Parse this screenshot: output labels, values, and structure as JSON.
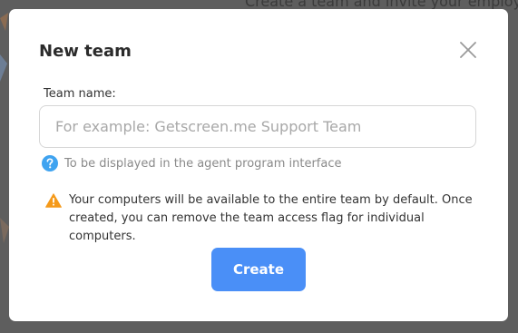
{
  "background": {
    "partial_text": "Create a team and invite your employee"
  },
  "modal": {
    "title": "New team",
    "close_icon": "close-icon",
    "team_name": {
      "label": "Team name:",
      "value": "",
      "placeholder": "For example: Getscreen.me Support Team"
    },
    "hint": {
      "icon": "question-circle-icon",
      "text": "To be displayed in the agent program interface"
    },
    "warning": {
      "icon": "warning-triangle-icon",
      "text": "Your computers will be available to the entire team by default. Once created, you can remove the team access flag for individual computers."
    },
    "create_label": "Create"
  },
  "colors": {
    "accent": "#4a8ff7",
    "hint_icon": "#3fa3f0",
    "warning_icon": "#f59a1a",
    "overlay": "#5e5e5e"
  }
}
